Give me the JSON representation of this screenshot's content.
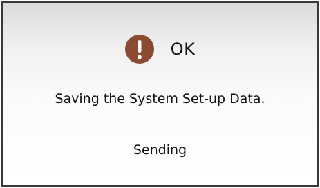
{
  "dialog": {
    "title": "OK",
    "icon": "exclamation-icon",
    "icon_color": "#8b4a32",
    "message": "Saving the System Set-up Data.",
    "status": "Sending"
  }
}
